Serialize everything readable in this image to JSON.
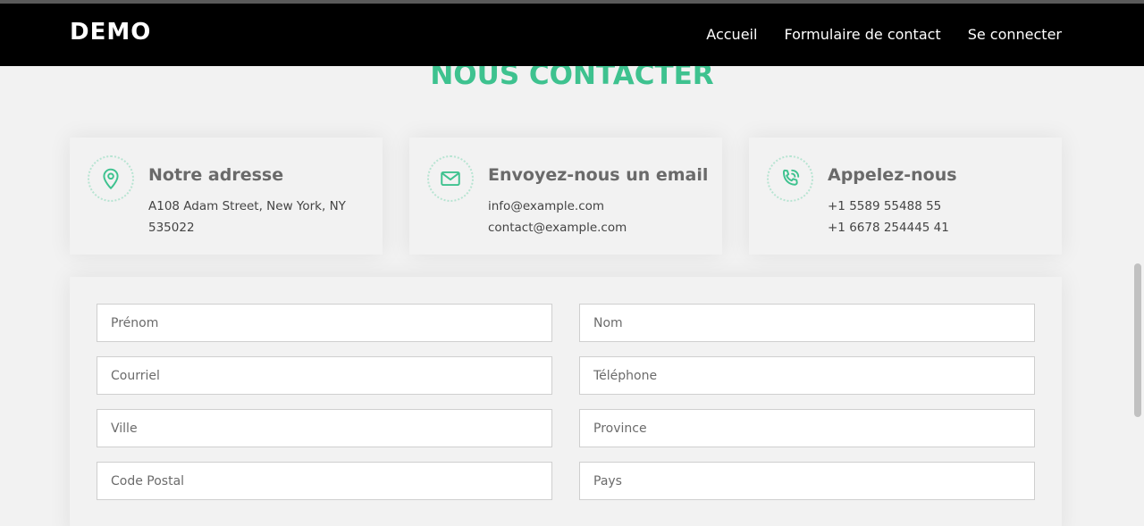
{
  "brand": "DEMO",
  "nav": {
    "links": [
      "Accueil",
      "Formulaire de contact",
      "Se connecter"
    ]
  },
  "section_title": "NOUS CONTACTER",
  "info_cards": [
    {
      "icon": "map-pin-icon",
      "title": "Notre adresse",
      "lines": [
        "A108 Adam Street, New York, NY 535022"
      ]
    },
    {
      "icon": "envelope-icon",
      "title": "Envoyez-nous un email",
      "lines": [
        "info@example.com",
        "contact@example.com"
      ]
    },
    {
      "icon": "phone-icon",
      "title": "Appelez-nous",
      "lines": [
        "+1 5589 55488 55",
        "+1 6678 254445 41"
      ]
    }
  ],
  "form": {
    "fields": {
      "first_name": {
        "placeholder": "Prénom",
        "value": ""
      },
      "last_name": {
        "placeholder": "Nom",
        "value": ""
      },
      "email": {
        "placeholder": "Courriel",
        "value": ""
      },
      "phone": {
        "placeholder": "Téléphone",
        "value": ""
      },
      "city": {
        "placeholder": "Ville",
        "value": ""
      },
      "province": {
        "placeholder": "Province",
        "value": ""
      },
      "postal_code": {
        "placeholder": "Code Postal",
        "value": ""
      },
      "country": {
        "placeholder": "Pays",
        "value": ""
      }
    }
  },
  "colors": {
    "accent": "#3ec28f",
    "navbar": "#000000",
    "background": "#f2f2f2"
  }
}
